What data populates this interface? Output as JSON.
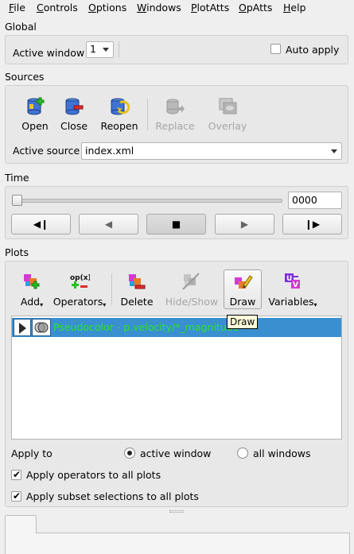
{
  "menubar": {
    "items": [
      "File",
      "Controls",
      "Options",
      "Windows",
      "PlotAtts",
      "OpAtts",
      "Help"
    ]
  },
  "global": {
    "title": "Global",
    "active_window_label": "Active window",
    "active_window_value": "1",
    "auto_apply_label": "Auto apply",
    "auto_apply_checked": false
  },
  "sources": {
    "title": "Sources",
    "buttons": {
      "open": "Open",
      "close": "Close",
      "reopen": "Reopen",
      "replace": "Replace",
      "overlay": "Overlay"
    },
    "active_source_label": "Active source",
    "active_source_value": "index.xml"
  },
  "time": {
    "title": "Time",
    "slider_position": 0,
    "frame_value": "0000",
    "vcr": {
      "step_back": "◀❙",
      "play_back": "◀",
      "stop": "■",
      "play": "▶",
      "step_forward": "❙▶"
    }
  },
  "plots": {
    "title": "Plots",
    "buttons": {
      "add": "Add",
      "operators": "Operators",
      "delete": "Delete",
      "hide_show": "Hide/Show",
      "draw": "Draw",
      "variables": "Variables"
    },
    "tooltip": "Draw",
    "plot_list": [
      {
        "name": "Pseudocolor - p.velocity/*_magnitude",
        "selected": true
      }
    ],
    "apply_to_label": "Apply to",
    "apply_to_options": [
      "active window",
      "all windows"
    ],
    "apply_to_selected": "active window",
    "apply_operators_label": "Apply operators to all plots",
    "apply_operators_checked": true,
    "apply_subset_label": "Apply subset selections to all plots",
    "apply_subset_checked": true
  },
  "colors": {
    "selection": "#3a8fd0",
    "plot_text": "#27e627",
    "accent_blue": "#3a6fc9"
  }
}
